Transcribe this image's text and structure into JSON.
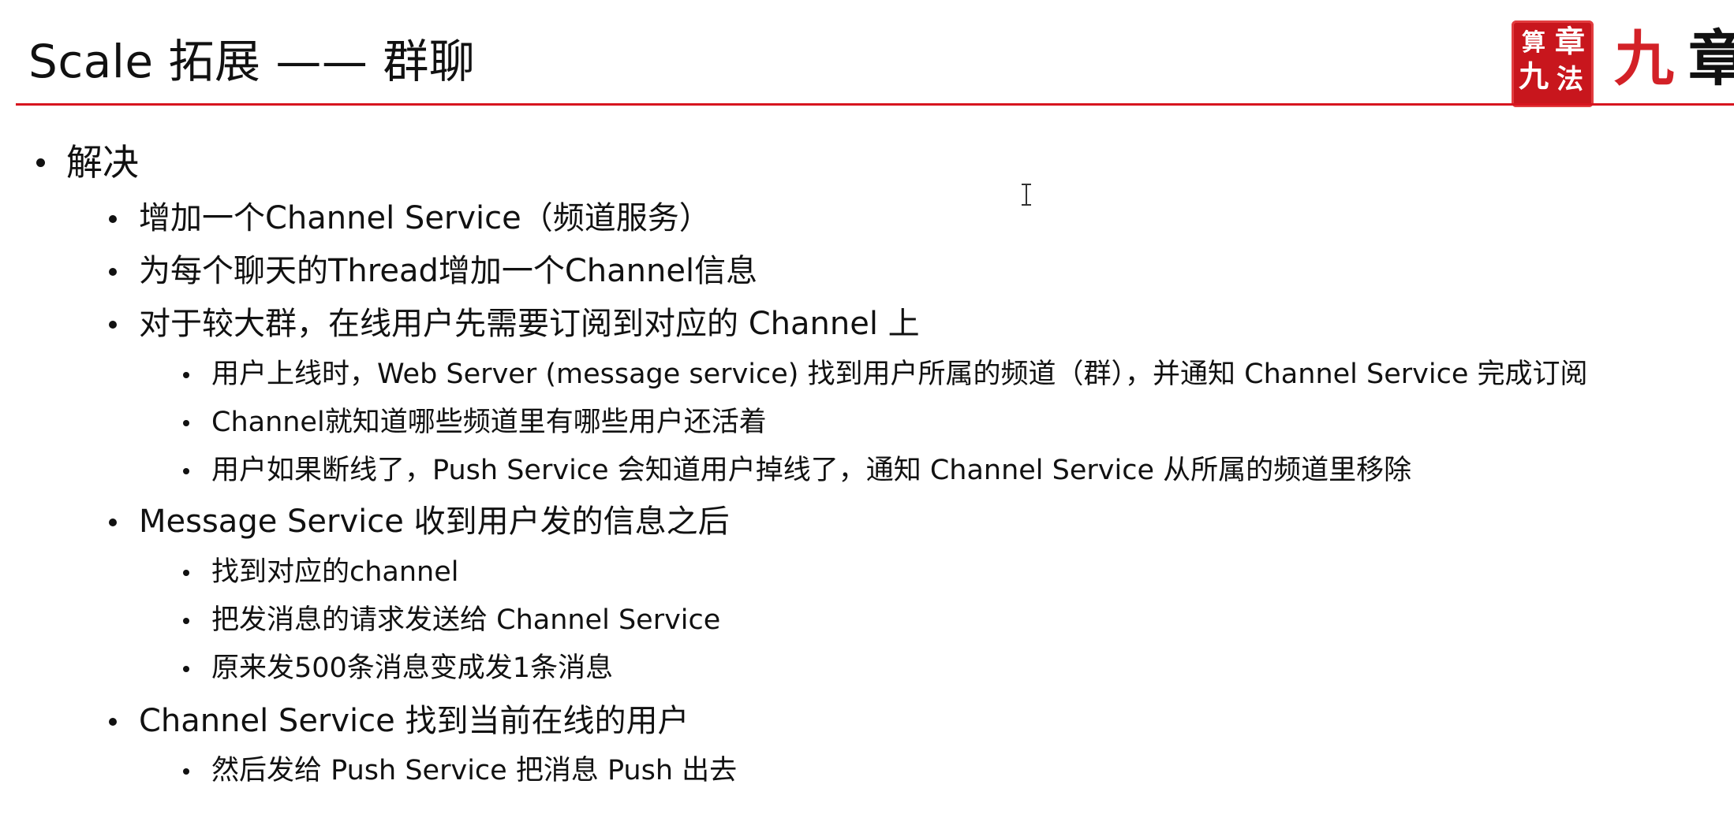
{
  "slide": {
    "title": "Scale 拓展 —— 群聊",
    "logo": {
      "seal_chars": [
        "九",
        "章",
        "算",
        "法"
      ],
      "brand_chars": [
        "九",
        "章"
      ],
      "accent_color": "#d7151f"
    },
    "bullets": [
      {
        "level": 1,
        "text": "解决"
      },
      {
        "level": 2,
        "text": "增加一个Channel Service（频道服务）"
      },
      {
        "level": 2,
        "text": "为每个聊天的Thread增加一个Channel信息"
      },
      {
        "level": 2,
        "text": "对于较大群，在线用户先需要订阅到对应的 Channel 上"
      },
      {
        "level": 3,
        "text": "用户上线时，Web Server (message service) 找到用户所属的频道（群），并通知 Channel Service 完成订阅"
      },
      {
        "level": 3,
        "text": "Channel就知道哪些频道里有哪些用户还活着"
      },
      {
        "level": 3,
        "text": "用户如果断线了，Push Service 会知道用户掉线了，通知 Channel Service 从所属的频道里移除"
      },
      {
        "level": 2,
        "text": "Message Service 收到用户发的信息之后"
      },
      {
        "level": 3,
        "text": "找到对应的channel"
      },
      {
        "level": 3,
        "text": "把发消息的请求发送给 Channel Service"
      },
      {
        "level": 3,
        "text": "原来发500条消息变成发1条消息"
      },
      {
        "level": 2,
        "text": "Channel Service 找到当前在线的用户"
      },
      {
        "level": 3,
        "text": "然后发给 Push Service 把消息 Push 出去"
      }
    ]
  }
}
